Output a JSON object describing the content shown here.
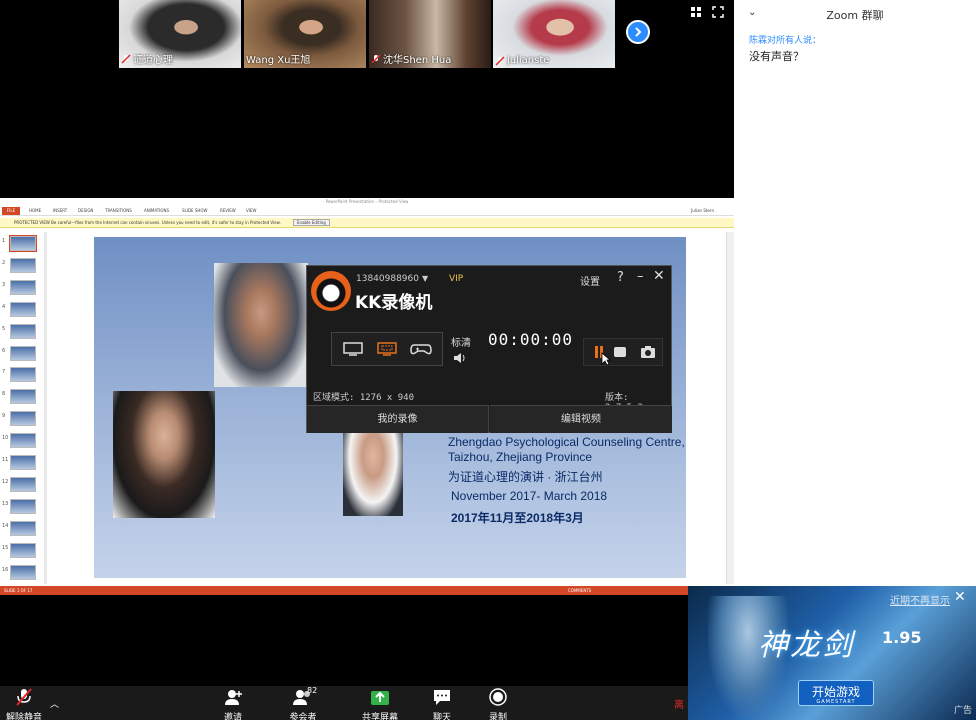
{
  "participants": [
    {
      "name": "证道心理",
      "muted": true
    },
    {
      "name": "Wang Xu王旭",
      "muted": false
    },
    {
      "name": "沈华Shen Hua",
      "muted": true
    },
    {
      "name": "julianste",
      "muted": true,
      "active": true
    }
  ],
  "chat": {
    "title": "Zoom 群聊",
    "from": "陈霖对所有人说：",
    "message": "没有声音？"
  },
  "ppt": {
    "window_title": "PowerPoint Presentation – Protected View",
    "tabs": [
      "HOME",
      "INSERT",
      "DESIGN",
      "TRANSITIONS",
      "ANIMATIONS",
      "SLIDE SHOW",
      "REVIEW",
      "VIEW"
    ],
    "file_tab": "FILE",
    "user": "Julian Stern",
    "protected_label": "PROTECTED VIEW",
    "protected_text": "Be careful—files from the Internet can contain viruses. Unless you need to edit, it's safer to stay in Protected View.",
    "enable_editing": "Enable Editing",
    "status_left": "SLIDE 1 OF 17",
    "status_right": "COMMENTS",
    "slide_numbers": [
      "1",
      "2",
      "3",
      "4",
      "5",
      "6",
      "7",
      "8",
      "9",
      "10",
      "11",
      "12",
      "13",
      "14",
      "15",
      "16"
    ]
  },
  "slide": {
    "line1a": "Zhengdao Psychological Counseling Centre,",
    "line1b": "Taizhou, Zhejiang Province",
    "line2": "为证道心理的演讲 · 浙江台州",
    "line3": "November 2017- March 2018",
    "line4": "2017年11月至2018年3月"
  },
  "recorder": {
    "phone": "13840988960",
    "vip": "VIP",
    "brand": "KK录像机",
    "settings": "设置",
    "quality": "标清",
    "timer": "00:00:00",
    "region": "区域模式: 1276 x 940",
    "version": "版本: 2.7.5.2",
    "my_recordings": "我的录像",
    "edit_video": "编辑视频"
  },
  "ad": {
    "dismiss": "近期不再显示",
    "game_title": "神龙剑",
    "version": "1.95",
    "play": "开始游戏",
    "play_sub": "GAMESTART",
    "ad_label": "广告"
  },
  "toolbar": {
    "unmute": "解除静音",
    "invite": "邀请",
    "participants": "参会者",
    "participant_count": "82",
    "share": "共享屏幕",
    "chat": "聊天",
    "record": "录制",
    "leave": "离"
  }
}
